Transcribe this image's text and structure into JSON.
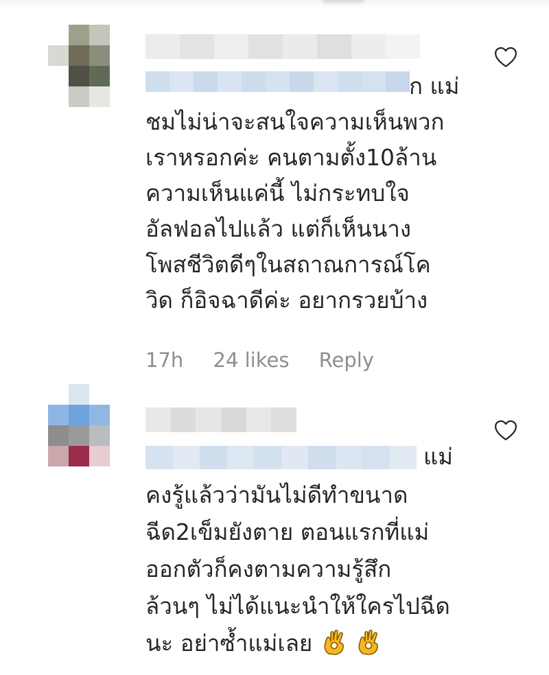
{
  "comments": [
    {
      "mention_suffix": "ก แม่",
      "lines": [
        "ชมไม่น่าจะสนใจความเห็นพวก",
        "เราหรอกค่ะ คนตามตั้ง10ล้าน",
        "ความเห็นแค่นี้ ไม่กระทบใจ",
        "อัลฟอลไปแล้ว แต่ก็เห็นนาง",
        "โพสชีวิตดีๆในสถาณการณ์โค",
        "วิด ก็อิจฉาดีค่ะ อยากรวยบ้าง"
      ],
      "time": "17h",
      "likes": "24 likes",
      "reply": "Reply"
    },
    {
      "mention_suffix": "แม่",
      "lines": [
        "คงรู้แล้วว่ามันไม่ดีทำขนาด",
        "ฉีด2เข็มยังตาย ตอนแรกที่แม่",
        "ออกตัวก็คงตามความรู้สึก",
        "ล้วนๆ ไม่ได้แนะนำให้ใครไปฉีด",
        "นะ อย่าซ้ำแม่เลย"
      ],
      "emoji": [
        "ok-hand-emoji",
        "ok-hand-emoji"
      ]
    }
  ],
  "icons": {
    "like": "heart-outline-icon"
  },
  "colors": {
    "text": "#262626",
    "meta": "#8e8e8e",
    "mention_blur": "#cfe0f0",
    "emoji": "#f5b820"
  }
}
